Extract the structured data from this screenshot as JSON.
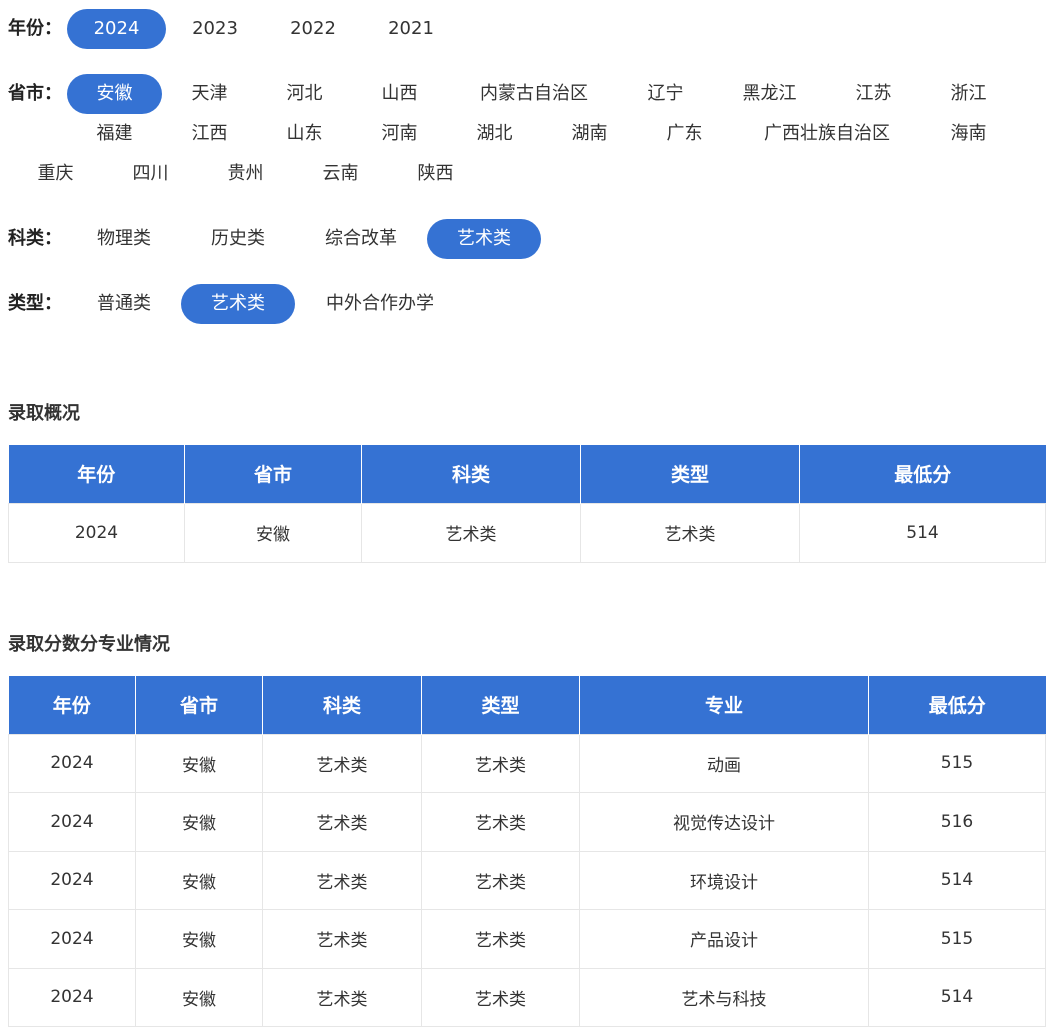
{
  "filters": {
    "year": {
      "label": "年份：",
      "options": [
        "2024",
        "2023",
        "2022",
        "2021"
      ],
      "selected": "2024"
    },
    "province": {
      "label": "省市：",
      "options": [
        "安徽",
        "天津",
        "河北",
        "山西",
        "内蒙古自治区",
        "辽宁",
        "黑龙江",
        "江苏",
        "浙江",
        "福建",
        "江西",
        "山东",
        "河南",
        "湖北",
        "湖南",
        "广东",
        "广西壮族自治区",
        "海南",
        "重庆",
        "四川",
        "贵州",
        "云南",
        "陕西"
      ],
      "selected": "安徽"
    },
    "subject": {
      "label": "科类：",
      "options": [
        "物理类",
        "历史类",
        "综合改革",
        "艺术类"
      ],
      "selected": "艺术类"
    },
    "type": {
      "label": "类型：",
      "options": [
        "普通类",
        "艺术类",
        "中外合作办学"
      ],
      "selected": "艺术类"
    }
  },
  "accent_color": "#3572d3",
  "overview": {
    "title": "录取概况",
    "headers": [
      "年份",
      "省市",
      "科类",
      "类型",
      "最低分"
    ],
    "rows": [
      [
        "2024",
        "安徽",
        "艺术类",
        "艺术类",
        "514"
      ]
    ]
  },
  "majors": {
    "title": "录取分数分专业情况",
    "headers": [
      "年份",
      "省市",
      "科类",
      "类型",
      "专业",
      "最低分"
    ],
    "rows": [
      [
        "2024",
        "安徽",
        "艺术类",
        "艺术类",
        "动画",
        "515"
      ],
      [
        "2024",
        "安徽",
        "艺术类",
        "艺术类",
        "视觉传达设计",
        "516"
      ],
      [
        "2024",
        "安徽",
        "艺术类",
        "艺术类",
        "环境设计",
        "514"
      ],
      [
        "2024",
        "安徽",
        "艺术类",
        "艺术类",
        "产品设计",
        "515"
      ],
      [
        "2024",
        "安徽",
        "艺术类",
        "艺术类",
        "艺术与科技",
        "514"
      ]
    ]
  }
}
